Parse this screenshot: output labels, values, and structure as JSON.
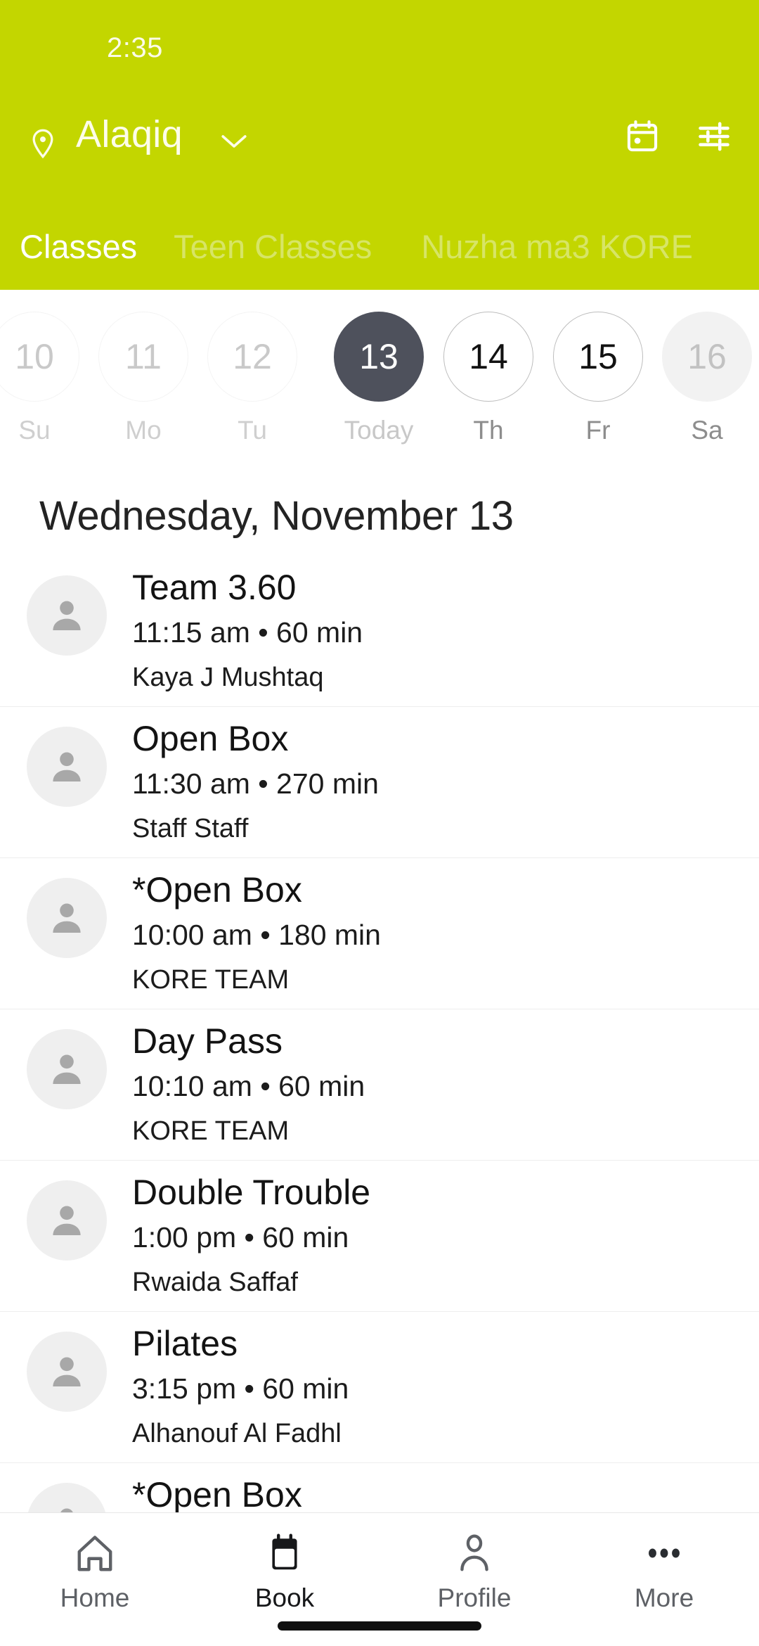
{
  "theme": {
    "brand_green": "#c3d600",
    "selected_day": "#4e515c",
    "header_text": "#ffffff",
    "tab_inactive": "#d7e566"
  },
  "status_bar": {
    "time": "2:35"
  },
  "header": {
    "location_name": "Alaqiq",
    "location_icon": "location-pin-icon",
    "caret_icon": "chevron-down-icon",
    "calendar_icon": "calendar-icon",
    "filter_icon": "filter-sliders-icon"
  },
  "tabs": [
    {
      "label": "Classes",
      "active": true
    },
    {
      "label": "Teen Classes",
      "active": false
    },
    {
      "label": "Nuzha ma3 KORE",
      "active": false
    }
  ],
  "date_strip": [
    {
      "day_number": "10",
      "day_label": "Su",
      "state": "past"
    },
    {
      "day_number": "11",
      "day_label": "Mo",
      "state": "past"
    },
    {
      "day_number": "12",
      "day_label": "Tu",
      "state": "past"
    },
    {
      "day_number": "13",
      "day_label": "Today",
      "state": "selected"
    },
    {
      "day_number": "14",
      "day_label": "Th",
      "state": "future"
    },
    {
      "day_number": "15",
      "day_label": "Fr",
      "state": "future"
    },
    {
      "day_number": "16",
      "day_label": "Sa",
      "state": "dim"
    }
  ],
  "date_heading": "Wednesday, November 13",
  "classes": [
    {
      "title": "Team 3.60",
      "meta": "11:15 am • 60 min",
      "staff": "Kaya J Mushtaq"
    },
    {
      "title": "Open Box",
      "meta": "11:30 am • 270 min",
      "staff": "Staff Staff"
    },
    {
      "title": "*Open Box",
      "meta": "10:00 am • 180 min",
      "staff": "KORE TEAM"
    },
    {
      "title": "Day Pass",
      "meta": "10:10 am • 60 min",
      "staff": "KORE TEAM"
    },
    {
      "title": "Double Trouble",
      "meta": "1:00 pm • 60 min",
      "staff": "Rwaida Saffaf"
    },
    {
      "title": "Pilates",
      "meta": "3:15 pm • 60 min",
      "staff": "Alhanouf Al Fadhl"
    },
    {
      "title": "*Open Box",
      "meta": "",
      "staff": ""
    }
  ],
  "bottom_nav": [
    {
      "label": "Home",
      "icon": "home-icon",
      "active": false
    },
    {
      "label": "Book",
      "icon": "calendar-filled-icon",
      "active": true
    },
    {
      "label": "Profile",
      "icon": "person-icon",
      "active": false
    },
    {
      "label": "More",
      "icon": "ellipsis-icon",
      "active": false
    }
  ]
}
